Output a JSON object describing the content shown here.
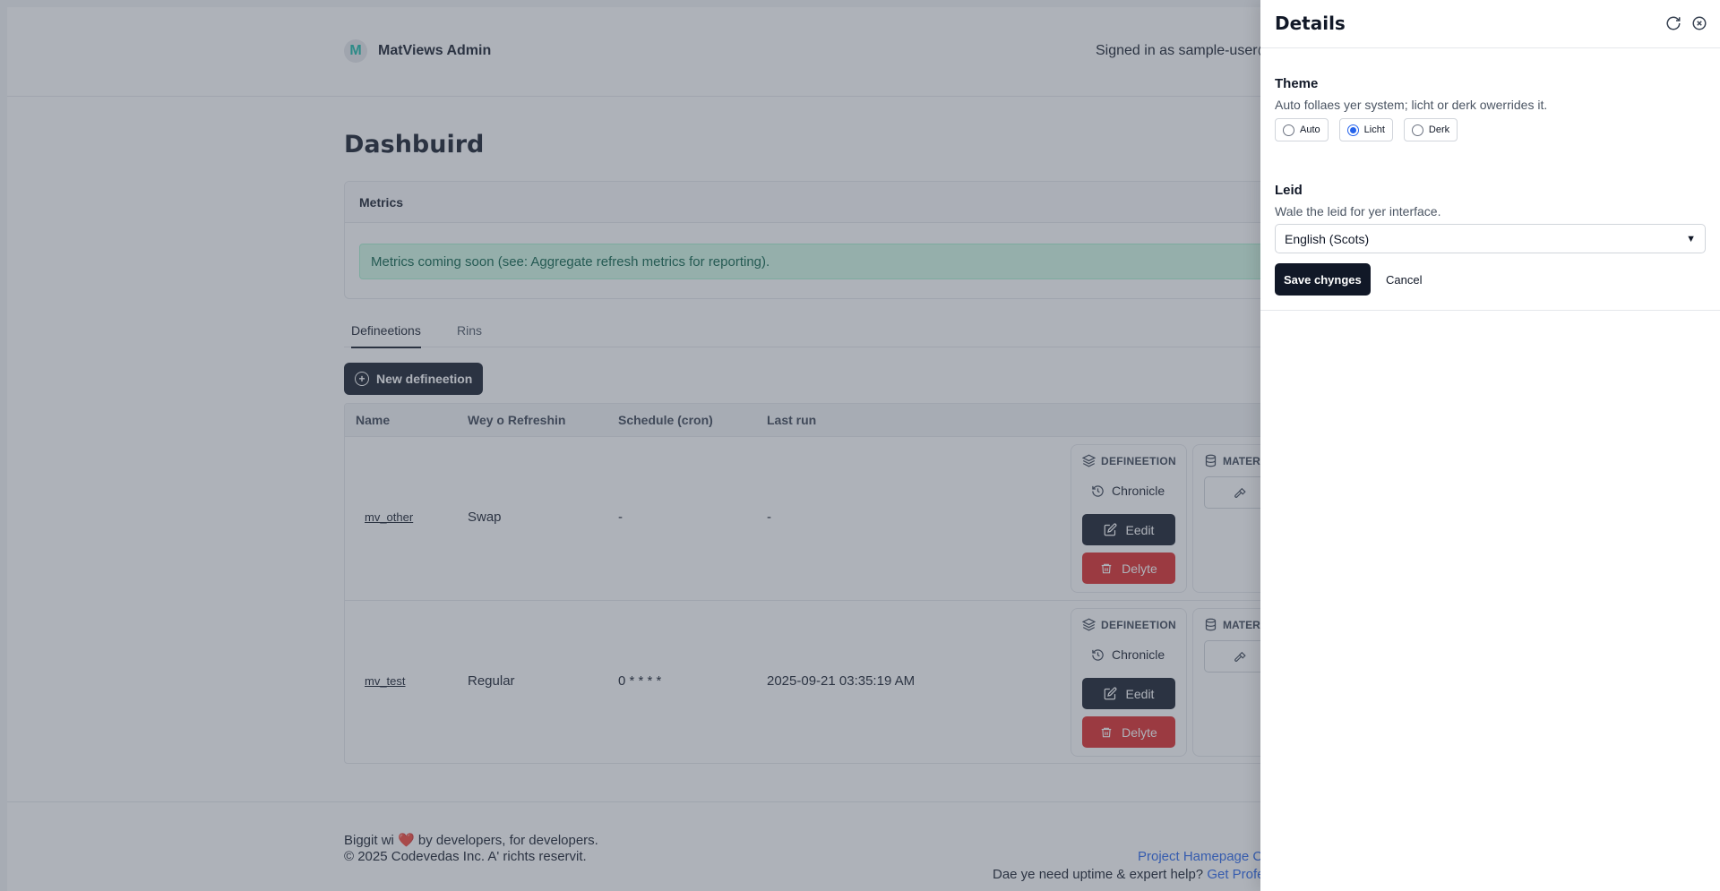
{
  "app": {
    "brand_name": "MatViews Admin",
    "brand_logo_letter": "M",
    "signed_in_text": "Signed in as sample-user@e"
  },
  "main": {
    "page_title": "Dashbuird",
    "metrics": {
      "title": "Metrics",
      "alert": "Metrics coming soon (see: Aggregate refresh metrics for reporting)."
    },
    "tabs": [
      {
        "label": "Defineetions",
        "active": true
      },
      {
        "label": "Rins",
        "active": false
      }
    ],
    "new_button_label": "New defineetion",
    "table": {
      "columns": [
        "Name",
        "Wey o Refreshin",
        "Schedule (cron)",
        "Last run"
      ],
      "rows": [
        {
          "name": "mv_other",
          "strategy": "Swap",
          "schedule": "-",
          "last_run": "-"
        },
        {
          "name": "mv_test",
          "strategy": "Regular",
          "schedule": "0 * * * *",
          "last_run": "2025-09-21 03:35:19 AM"
        }
      ],
      "actions": {
        "definition_title": "DEFINEETION",
        "chronicle_label": "Chronicle",
        "edit_label": "Eedit",
        "delete_label": "Delyte",
        "mater_title": "MATER"
      }
    }
  },
  "footer": {
    "line1_before": "Biggit wi",
    "line1_after": "by developers, for developers.",
    "line2": "© 2025 Codevedas Inc. A' richts reservit.",
    "right_link": "Project Hamepage C",
    "help_text": "Dae ye need uptime & expert help?",
    "help_link": "Get Profe"
  },
  "panel": {
    "title": "Details",
    "theme": {
      "label": "Theme",
      "help": "Auto follaes yer system; licht or derk owerrides it.",
      "options": [
        {
          "label": "Auto",
          "selected": false
        },
        {
          "label": "Licht",
          "selected": true
        },
        {
          "label": "Derk",
          "selected": false
        }
      ]
    },
    "language": {
      "label": "Leid",
      "help": "Wale the leid for yer interface.",
      "selected": "English (Scots)"
    },
    "save_label": "Save chynges",
    "cancel_label": "Cancel"
  },
  "colors": {
    "primary": "#111827",
    "danger": "#dc2626",
    "success_bg": "#d1fae5",
    "success_text": "#065f46",
    "link": "#2563eb",
    "radio_accent": "#2563eb"
  }
}
